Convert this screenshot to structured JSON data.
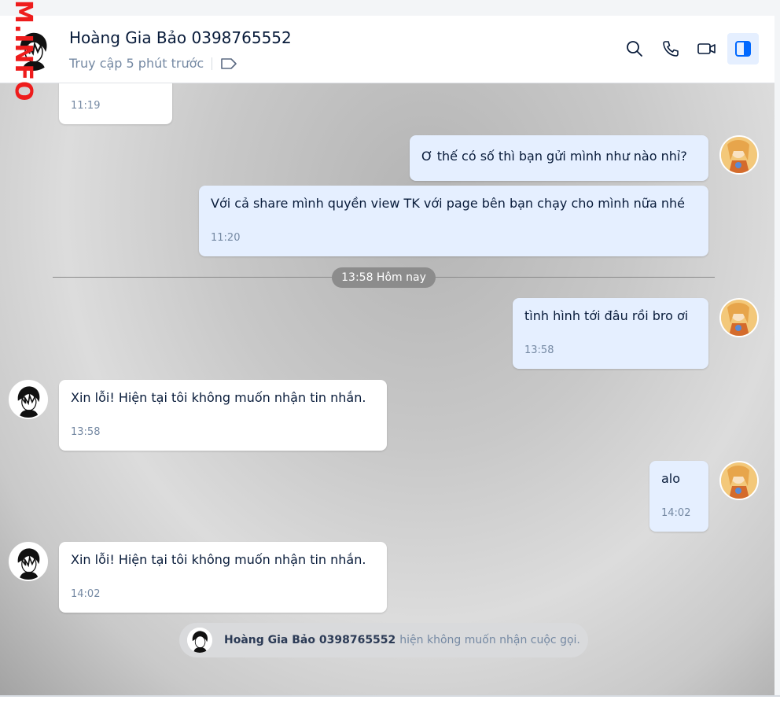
{
  "header": {
    "contact_name": "Hoàng Gia Bảo 0398765552",
    "status": "Truy cập 5 phút trước"
  },
  "watermark": "M.INFO",
  "messages": [
    {
      "direction": "in",
      "text": "",
      "time": "11:19"
    },
    {
      "direction": "out",
      "text": "Ơ thế có số thì bạn gửi mình như nào nhỉ?",
      "time": ""
    },
    {
      "direction": "out",
      "text": "Với cả share mình quyền view TK với page bên bạn chạy cho mình nữa nhé",
      "time": "11:20"
    },
    {
      "direction": "out",
      "text": "tình hình tới đâu rồi bro ơi",
      "time": "13:58"
    },
    {
      "direction": "in",
      "text": "Xin lỗi! Hiện tại tôi không muốn nhận tin nhắn.",
      "time": "13:58"
    },
    {
      "direction": "out",
      "text": "alo",
      "time": "14:02"
    },
    {
      "direction": "in",
      "text": "Xin lỗi! Hiện tại tôi không muốn nhận tin nhắn.",
      "time": "14:02"
    }
  ],
  "divider": "13:58 Hôm nay",
  "notice": {
    "name": "Hoàng Gia Bảo 0398765552",
    "text": "hiện không muốn nhận cuộc gọi."
  },
  "colors": {
    "outgoing_bubble": "#e5efff",
    "incoming_bubble": "#ffffff",
    "accent": "#0068ff",
    "watermark": "#ee1c1c"
  },
  "icons": {
    "search": "search-icon",
    "call": "phone-icon",
    "video": "video-camera-icon",
    "panel": "sidebar-toggle-icon",
    "tag": "tag-icon"
  }
}
